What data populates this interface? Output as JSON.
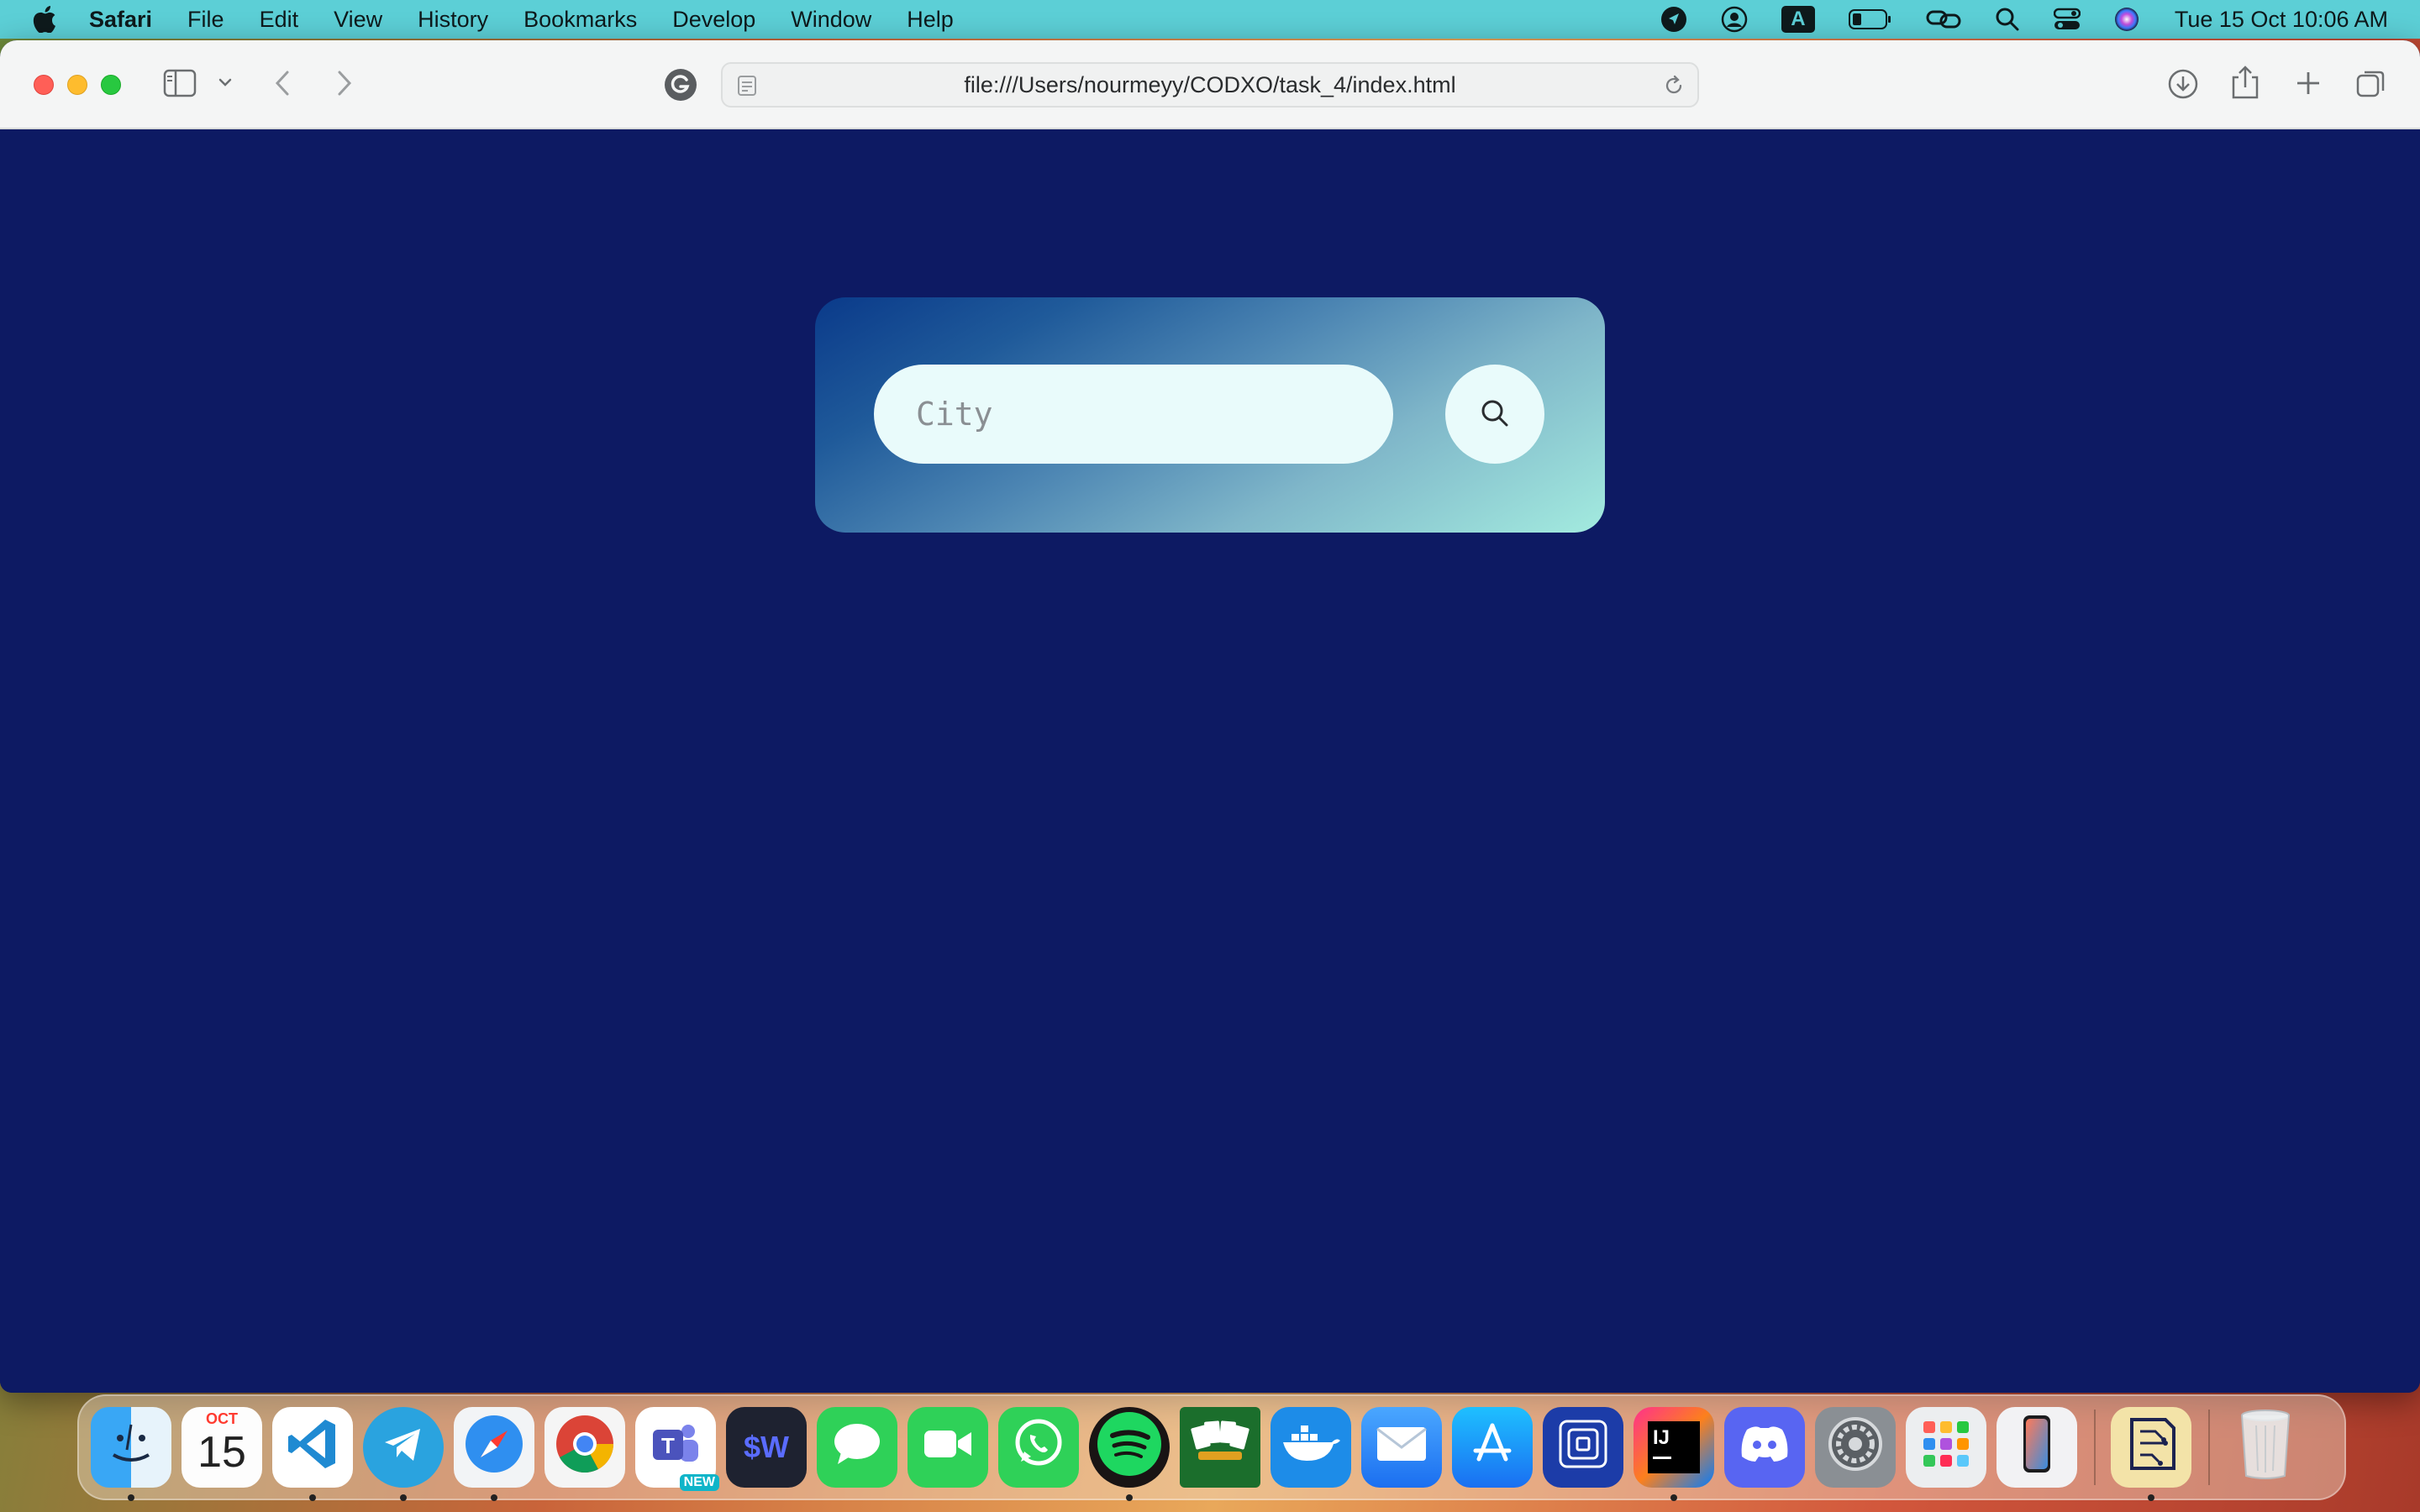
{
  "menubar": {
    "app_name": "Safari",
    "items": [
      "File",
      "Edit",
      "View",
      "History",
      "Bookmarks",
      "Develop",
      "Window",
      "Help"
    ],
    "input_badge": "A",
    "clock": "Tue 15 Oct  10:06 AM"
  },
  "browser": {
    "url": "file:///Users/nourmeyy/CODXO/task_4/index.html"
  },
  "page": {
    "search": {
      "placeholder": "City",
      "value": ""
    },
    "colors": {
      "background": "#0d1a63",
      "card_gradient_start": "#0a3a8a",
      "card_gradient_end": "#a3ebdf",
      "input_bg": "#e9fbfb"
    }
  },
  "dock": {
    "calendar_month": "OCT",
    "calendar_day": "15",
    "teams_badge": "NEW",
    "warp_label": "$W",
    "intellij_label": "IJ",
    "apps": [
      "finder",
      "calendar",
      "vscode",
      "telegram",
      "safari",
      "chrome",
      "teams",
      "warp",
      "messages",
      "facetime",
      "whatsapp",
      "spotify",
      "solitaire",
      "docker",
      "mail",
      "app-store",
      "network-radar",
      "intellij",
      "discord",
      "system-settings",
      "launchpad",
      "iphone-mirroring",
      "circuit-app",
      "trash"
    ]
  }
}
